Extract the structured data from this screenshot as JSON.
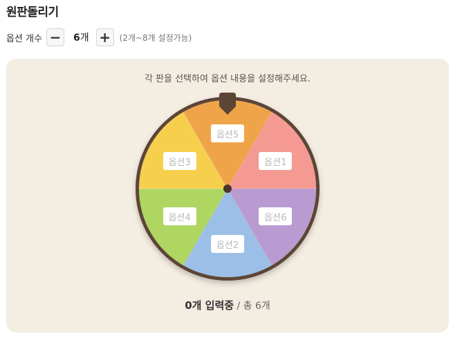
{
  "header": {
    "title": "원판돌리기"
  },
  "options_count": {
    "label": "옵션 개수",
    "minus_symbol": "−",
    "plus_symbol": "+",
    "value": "6",
    "unit": "개",
    "hint": "(2개~8개 설정가능)"
  },
  "wheel": {
    "instruction": "각 판을 선택하여 옵션 내용을 설정해주세요.",
    "segments": [
      {
        "label": "옵션1",
        "color": "#f59a93"
      },
      {
        "label": "옵션6",
        "color": "#b99bd1"
      },
      {
        "label": "옵션2",
        "color": "#9bbfe6"
      },
      {
        "label": "옵션4",
        "color": "#aed661"
      },
      {
        "label": "옵션3",
        "color": "#f6d04d"
      },
      {
        "label": "옵션5",
        "color": "#f0a44a"
      }
    ],
    "rim_color": "#5c4535",
    "pointer_icon": "pointer-marker-icon"
  },
  "status": {
    "count_text": "0개 입력중",
    "total_text": " / 총 6개"
  },
  "colors": {
    "panel_bg": "#f4ede2"
  }
}
